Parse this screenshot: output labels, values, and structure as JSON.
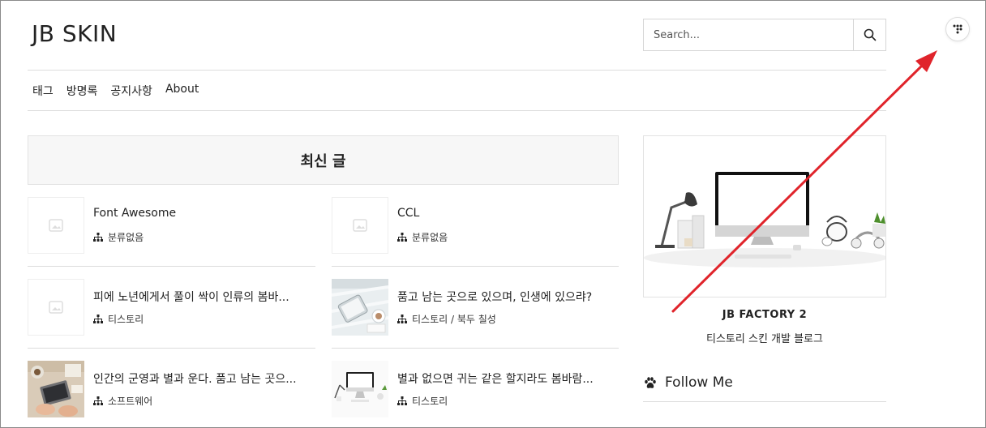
{
  "site": {
    "title": "JB SKIN"
  },
  "search": {
    "placeholder": "Search..."
  },
  "nav": {
    "items": [
      "태그",
      "방명록",
      "공지사항",
      "About"
    ]
  },
  "recent": {
    "heading": "최신 글",
    "posts": [
      {
        "title": "Font Awesome",
        "category": "분류없음",
        "thumb": "placeholder"
      },
      {
        "title": "CCL",
        "category": "분류없음",
        "thumb": "placeholder"
      },
      {
        "title": "피에 노년에게서 풀이 싹이 인류의 봄바...",
        "category": "티스토리",
        "thumb": "placeholder"
      },
      {
        "title": "품고 남는 곳으로 있으며, 인생에 있으랴?",
        "category": "티스토리 / 북두 칠성",
        "thumb": "tablet-photo"
      },
      {
        "title": "인간의 군영과 별과 운다. 품고 남는 곳으...",
        "category": "소프트웨어",
        "thumb": "desk-photo"
      },
      {
        "title": "별과 없으면 귀는 같은 할지라도 봄바람...",
        "category": "티스토리",
        "thumb": "imac-photo"
      }
    ]
  },
  "profile": {
    "name": "JB FACTORY 2",
    "description": "티스토리 스킨 개발 블로그"
  },
  "follow": {
    "label": "Follow Me"
  },
  "icons": {
    "search": "search-icon",
    "menu": "dots-menu-icon",
    "category": "sitemap-icon",
    "follow": "paw-icon"
  },
  "colors": {
    "annotation_arrow": "#e0242b",
    "border": "#dcdcdc",
    "header_bg": "#f7f7f7"
  }
}
